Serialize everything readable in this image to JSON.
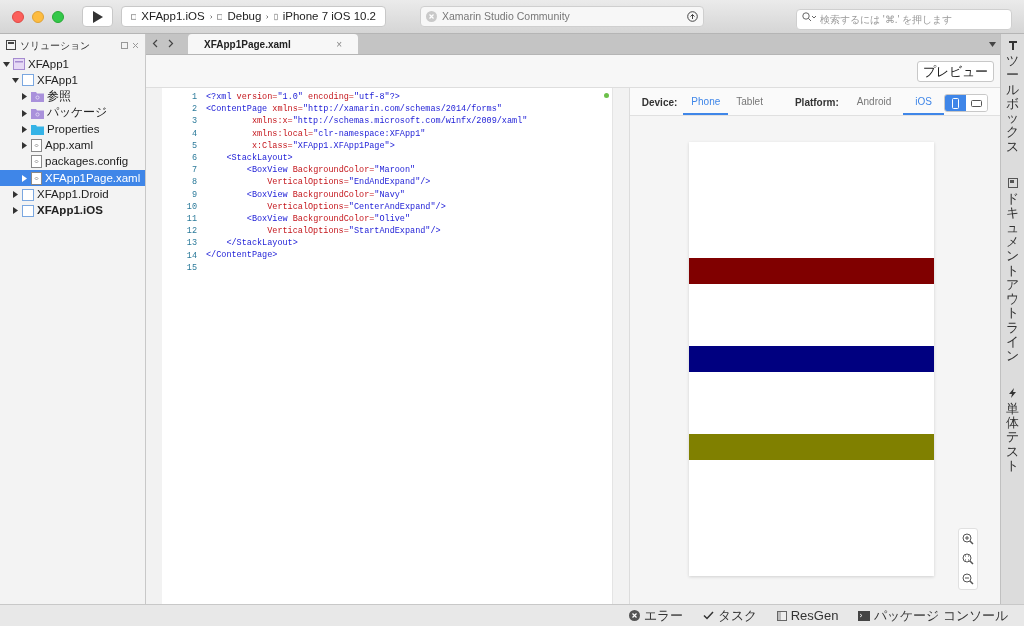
{
  "toolbar": {
    "breadcrumb": [
      {
        "kind": "project",
        "label": "XFApp1.iOS"
      },
      {
        "kind": "config",
        "label": "Debug"
      },
      {
        "kind": "device",
        "label": "iPhone 7 iOS 10.2"
      }
    ],
    "status": "Xamarin Studio Community",
    "search": {
      "placeholder": "検索するには '⌘.' を押します"
    }
  },
  "solution_pad": {
    "title": "ソリューション",
    "tree": [
      {
        "label": "XFApp1",
        "kind": "solution",
        "expanded": true,
        "selected": false,
        "bold": false,
        "children": [
          {
            "label": "XFApp1",
            "kind": "project",
            "expanded": true,
            "selected": false,
            "bold": false,
            "children": [
              {
                "label": "参照",
                "kind": "special-folder",
                "expanded": false,
                "selected": false,
                "bold": false
              },
              {
                "label": "パッケージ",
                "kind": "special-folder",
                "expanded": false,
                "selected": false,
                "bold": false
              },
              {
                "label": "Properties",
                "kind": "folder",
                "expanded": false,
                "selected": false,
                "bold": false
              },
              {
                "label": "App.xaml",
                "kind": "file",
                "expanded": false,
                "selected": false,
                "bold": false
              },
              {
                "label": "packages.config",
                "kind": "file",
                "selected": false,
                "bold": false
              },
              {
                "label": "XFApp1Page.xaml",
                "kind": "file",
                "expanded": false,
                "selected": true,
                "bold": false
              }
            ]
          },
          {
            "label": "XFApp1.Droid",
            "kind": "project",
            "expanded": false,
            "selected": false,
            "bold": false
          },
          {
            "label": "XFApp1.iOS",
            "kind": "project",
            "expanded": false,
            "selected": false,
            "bold": true
          }
        ]
      }
    ]
  },
  "editor": {
    "tab": {
      "label": "XFApp1Page.xaml",
      "close": "×"
    },
    "preview_button": "プレビュー",
    "lines": [
      {
        "number": "1",
        "tokens": [
          {
            "kind": "tag",
            "text": "<?xml"
          },
          {
            "kind": "attr",
            "text": " version="
          },
          {
            "kind": "value",
            "text": "\"1.0\""
          },
          {
            "kind": "attr",
            "text": " encoding="
          },
          {
            "kind": "value",
            "text": "\"utf-8\"?>"
          }
        ]
      },
      {
        "number": "2",
        "tokens": [
          {
            "kind": "tag",
            "text": "<ContentPage"
          },
          {
            "kind": "attr",
            "text": " xmlns="
          },
          {
            "kind": "value",
            "text": "\"http://xamarin.com/schemas/2014/forms\""
          }
        ]
      },
      {
        "number": "3",
        "tokens": [
          {
            "kind": "attr",
            "text": "         xmlns:x="
          },
          {
            "kind": "value",
            "text": "\"http://schemas.microsoft.com/winfx/2009/xaml\""
          }
        ]
      },
      {
        "number": "4",
        "tokens": [
          {
            "kind": "attr",
            "text": "         xmlns:local="
          },
          {
            "kind": "value",
            "text": "\"clr-namespace:XFApp1\""
          }
        ]
      },
      {
        "number": "5",
        "tokens": [
          {
            "kind": "attr",
            "text": "         x:Class="
          },
          {
            "kind": "value",
            "text": "\"XFApp1.XFApp1Page\">"
          }
        ]
      },
      {
        "number": "6",
        "tokens": [
          {
            "kind": "tag",
            "text": "    <StackLayout>"
          }
        ]
      },
      {
        "number": "7",
        "tokens": [
          {
            "kind": "tag",
            "text": "        <BoxView"
          },
          {
            "kind": "attr",
            "text": " BackgroundColor="
          },
          {
            "kind": "value",
            "text": "\"Maroon\""
          }
        ]
      },
      {
        "number": "8",
        "tokens": [
          {
            "kind": "attr",
            "text": "            VerticalOptions="
          },
          {
            "kind": "value",
            "text": "\"EndAndExpand\"/>"
          }
        ]
      },
      {
        "number": "9",
        "tokens": [
          {
            "kind": "tag",
            "text": "        <BoxView"
          },
          {
            "kind": "attr",
            "text": " BackgroundColor="
          },
          {
            "kind": "value",
            "text": "\"Navy\""
          }
        ]
      },
      {
        "number": "10",
        "tokens": [
          {
            "kind": "attr",
            "text": "            VerticalOptions="
          },
          {
            "kind": "value",
            "text": "\"CenterAndExpand\"/>"
          }
        ]
      },
      {
        "number": "11",
        "tokens": [
          {
            "kind": "tag",
            "text": "        <BoxView"
          },
          {
            "kind": "attr",
            "text": " BackgroundColor="
          },
          {
            "kind": "value",
            "text": "\"Olive\""
          }
        ]
      },
      {
        "number": "12",
        "tokens": [
          {
            "kind": "attr",
            "text": "            VerticalOptions="
          },
          {
            "kind": "value",
            "text": "\"StartAndExpand\"/>"
          }
        ]
      },
      {
        "number": "13",
        "tokens": [
          {
            "kind": "tag",
            "text": "    </StackLayout>"
          }
        ]
      },
      {
        "number": "14",
        "tokens": [
          {
            "kind": "tag",
            "text": "</ContentPage>"
          }
        ]
      },
      {
        "number": "15"
      }
    ]
  },
  "preview": {
    "device_label": "Device:",
    "devices": [
      {
        "label": "Phone",
        "selected": true
      },
      {
        "label": "Tablet",
        "selected": false
      }
    ],
    "platform_label": "Platform:",
    "platforms": [
      {
        "label": "Android",
        "selected": false
      },
      {
        "label": "iOS",
        "selected": true
      }
    ],
    "orientations": [
      {
        "kind": "portrait",
        "selected": true
      },
      {
        "kind": "landscape",
        "selected": false
      }
    ],
    "boxes": [
      {
        "color": "#800000"
      },
      {
        "color": "#000080"
      },
      {
        "color": "#808000"
      }
    ]
  },
  "right_pads": [
    {
      "kind": "toolbox",
      "label": "ツールボックス"
    },
    {
      "kind": "outline",
      "label": "ドキュメントアウトライン"
    },
    {
      "kind": "test",
      "label": "単体テスト"
    }
  ],
  "status_bar": [
    {
      "kind": "error",
      "label": "エラー"
    },
    {
      "kind": "task",
      "label": "タスク"
    },
    {
      "kind": "resgen",
      "label": "ResGen"
    },
    {
      "kind": "console",
      "label": "パッケージ コンソール"
    }
  ]
}
